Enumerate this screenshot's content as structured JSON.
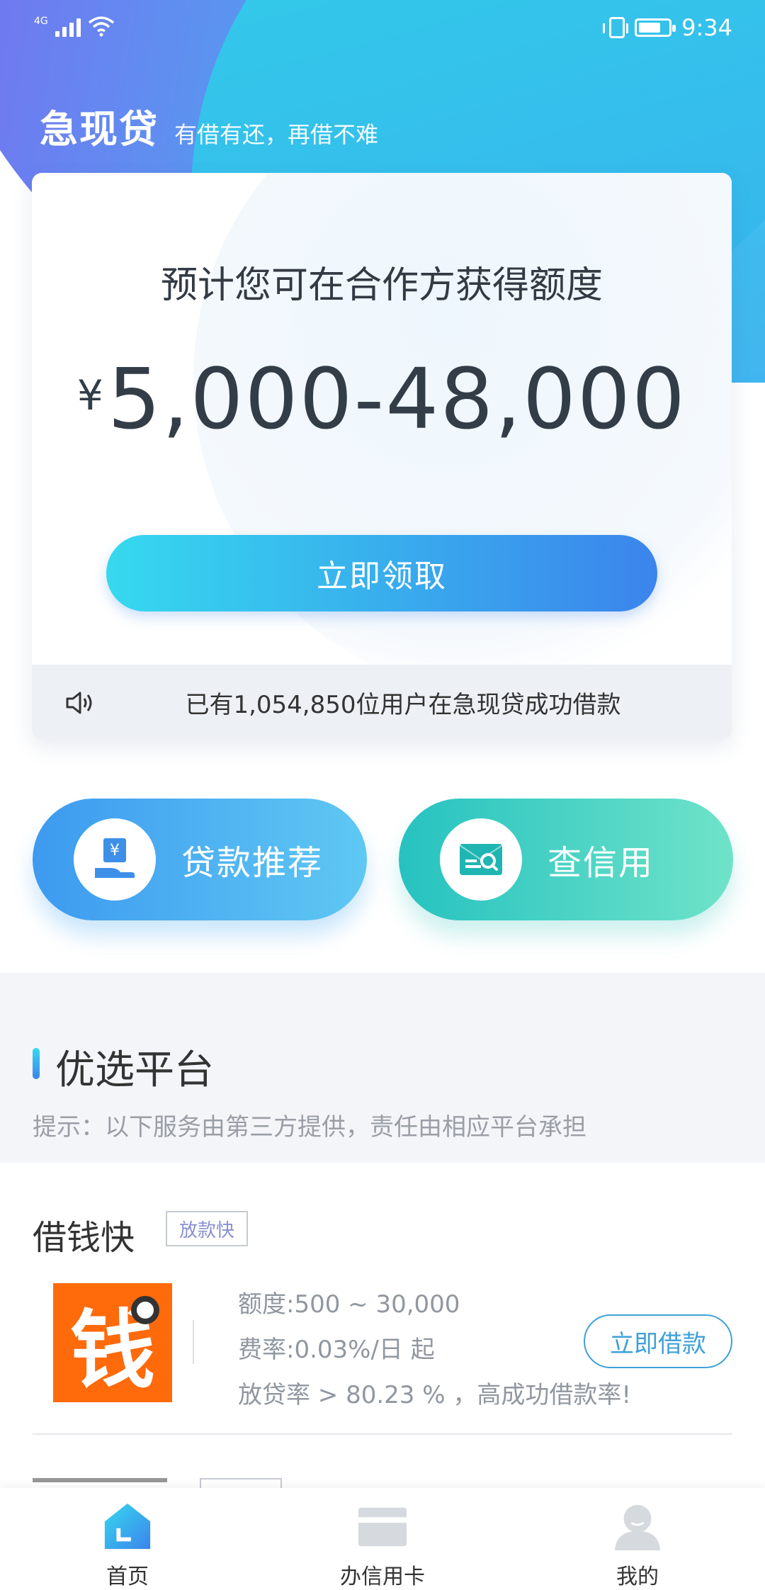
{
  "status_bar": {
    "network": "4G",
    "time": "9:34"
  },
  "brand": {
    "name": "急现贷",
    "slogan": "有借有还，再借不难"
  },
  "quota_card": {
    "title": "预计您可在合作方获得额度",
    "currency_symbol": "¥",
    "amount": "5,000-48,000",
    "cta_label": "立即领取",
    "notice": "已有1,054,850位用户在急现贷成功借款"
  },
  "shortcuts": [
    {
      "label": "贷款推荐",
      "icon": "loan-hand-icon"
    },
    {
      "label": "查信用",
      "icon": "credit-search-icon"
    }
  ],
  "section": {
    "title": "优选平台",
    "hint": "提示：以下服务由第三方提供，责任由相应平台承担"
  },
  "platforms": [
    {
      "name": "借钱快",
      "tag": "放款快",
      "logo_char": "钱",
      "limit": "额度:500 ~ 30,000",
      "rate": "费率:0.03%/日 起",
      "approval": "放贷率 > 80.23 % ，高成功借款率!",
      "button_label": "立即借款"
    }
  ],
  "tabbar": {
    "items": [
      {
        "label": "首页",
        "icon": "home-icon",
        "active": true
      },
      {
        "label": "办信用卡",
        "icon": "credit-card-icon",
        "active": false
      },
      {
        "label": "我的",
        "icon": "profile-icon",
        "active": false
      }
    ]
  },
  "colors": {
    "brand_gradient_start": "#7a6cf0",
    "brand_gradient_end": "#37c9e6",
    "cta_start": "#36d9ee",
    "cta_end": "#3b84ec",
    "logo_orange": "#ff6a0b",
    "link_blue": "#3ea0d8"
  }
}
